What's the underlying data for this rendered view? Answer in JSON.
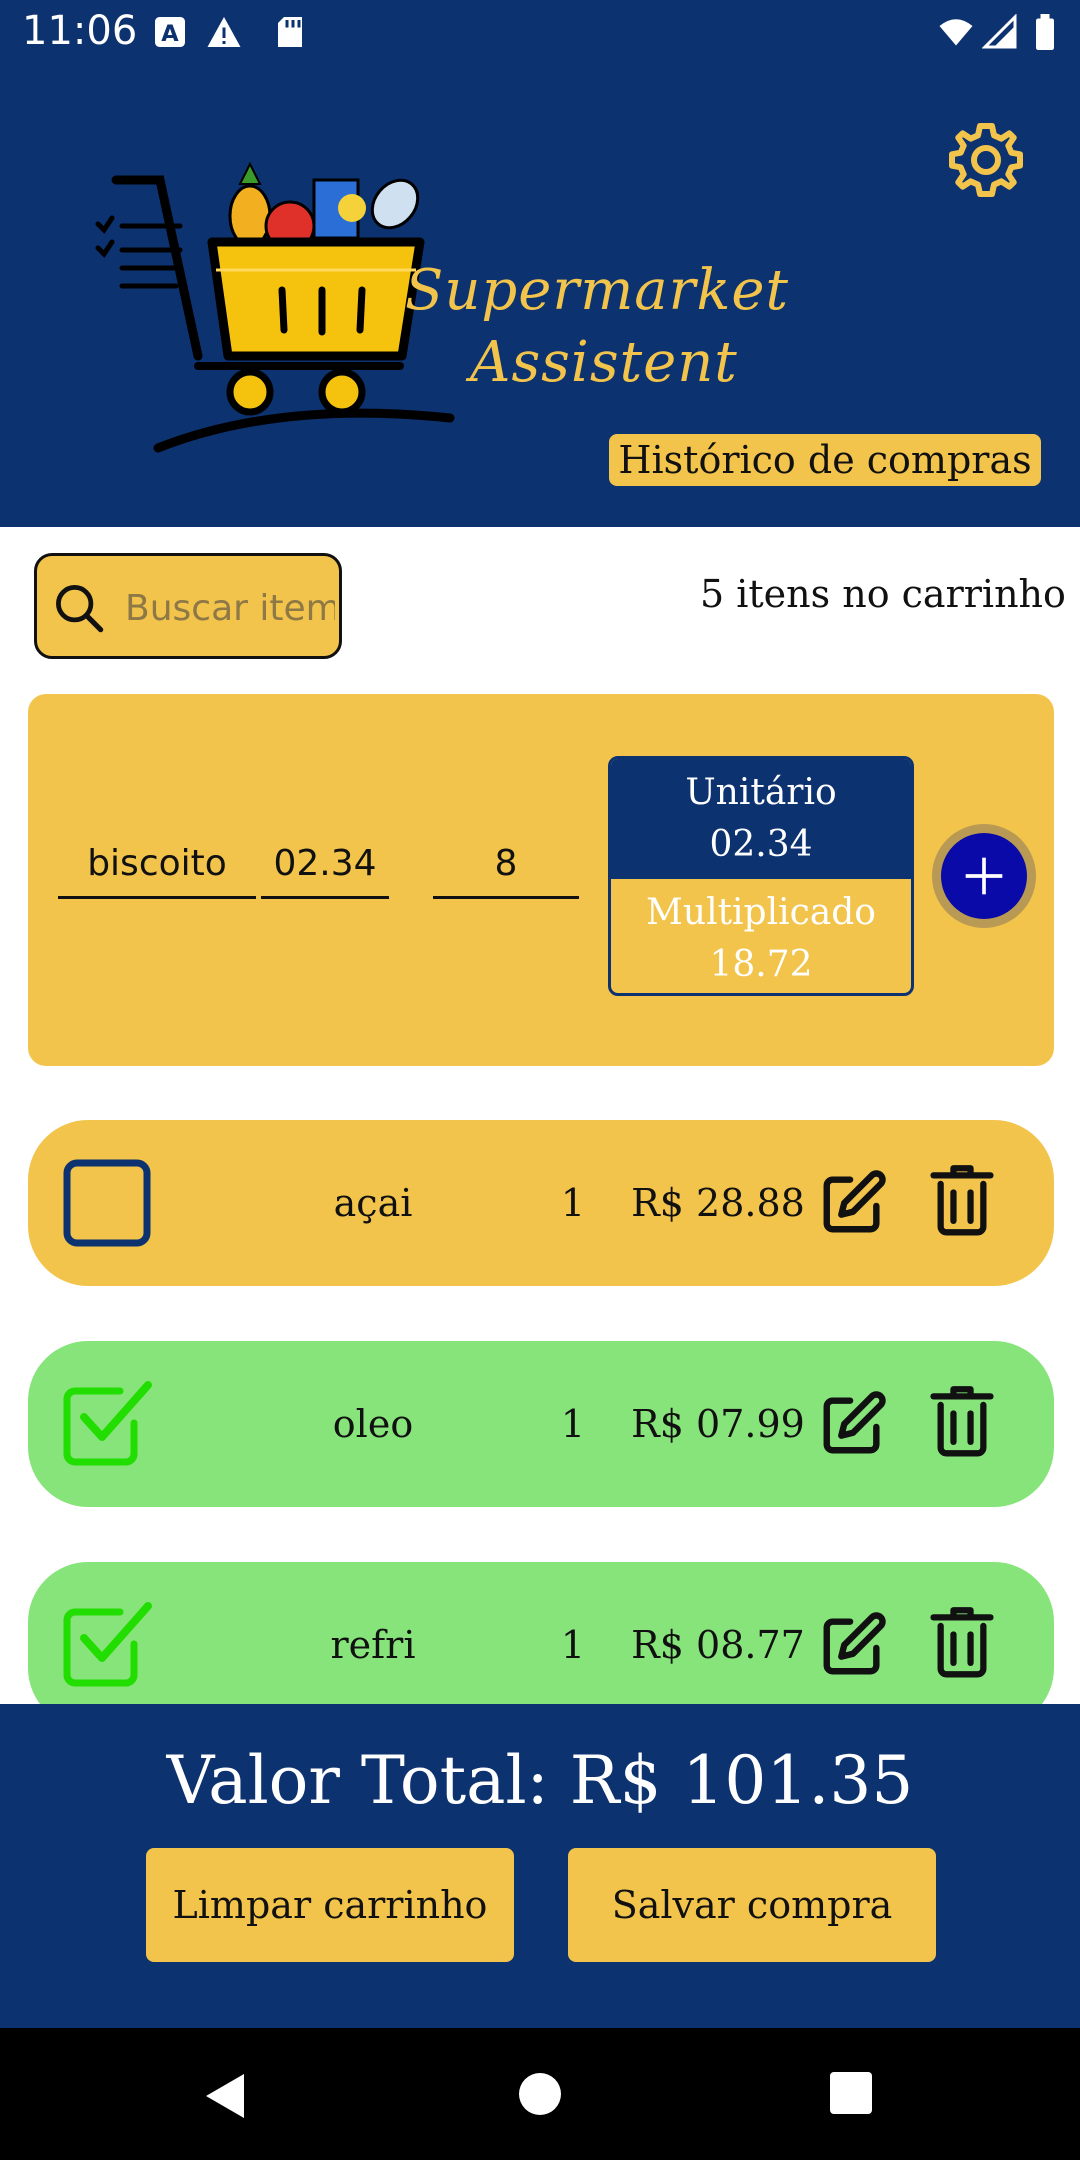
{
  "status_bar": {
    "time": "11:06",
    "left_icons": [
      "a-box-icon",
      "warning-icon",
      "sd-card-icon"
    ],
    "right_icons": [
      "wifi-icon",
      "signal-icon",
      "battery-icon"
    ]
  },
  "header": {
    "title_line1": "Supermarket",
    "title_line2": "Assistent",
    "history_button": "Histórico de compras",
    "settings_icon": "gear-icon"
  },
  "search": {
    "placeholder": "Buscar item"
  },
  "cart_count_text": "5 itens no carrinho",
  "add_form": {
    "name_value": "biscoito",
    "price_value": "02.34",
    "quantity_value": "8",
    "unit_label": "Unitário",
    "unit_value": "02.34",
    "multiplied_label": "Multiplicado",
    "multiplied_value": "18.72",
    "add_icon": "plus-icon"
  },
  "items": [
    {
      "name": "açai",
      "qty": "1",
      "price": "R$ 28.88",
      "checked": false
    },
    {
      "name": "oleo",
      "qty": "1",
      "price": "R$ 07.99",
      "checked": true
    },
    {
      "name": "refri",
      "qty": "1",
      "price": "R$ 08.77",
      "checked": true
    }
  ],
  "footer": {
    "total_text": "Valor Total: R$ 101.35",
    "clear_button": "Limpar carrinho",
    "save_button": "Salvar compra"
  },
  "colors": {
    "primary_navy": "#0d3270",
    "accent_yellow": "#f2c44c",
    "checked_green": "#87e47a",
    "check_mark_green": "#22dd00",
    "fab_blue": "#0a0aa8"
  }
}
